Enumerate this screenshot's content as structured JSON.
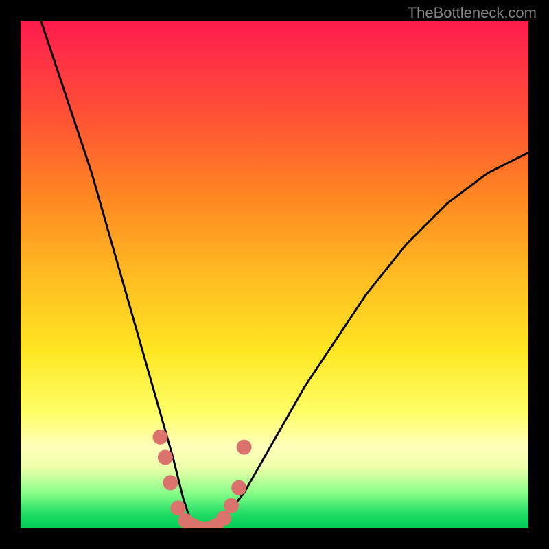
{
  "watermark": "TheBottleneck.com",
  "chart_data": {
    "type": "line",
    "title": "",
    "xlabel": "",
    "ylabel": "",
    "xlim": [
      0,
      100
    ],
    "ylim": [
      0,
      100
    ],
    "series": [
      {
        "name": "bottleneck-curve",
        "x": [
          4,
          6,
          8,
          10,
          12,
          14,
          16,
          18,
          20,
          22,
          24,
          26,
          28,
          30,
          31,
          32,
          33,
          34,
          36,
          38,
          40,
          44,
          48,
          52,
          56,
          60,
          64,
          68,
          72,
          76,
          80,
          84,
          88,
          92,
          96,
          100
        ],
        "values": [
          100,
          94,
          88,
          82,
          76,
          70,
          63,
          56,
          49,
          42,
          35,
          28,
          21,
          14,
          10,
          6,
          3,
          1,
          0,
          0,
          2,
          7,
          14,
          21,
          28,
          34,
          40,
          46,
          51,
          56,
          60,
          64,
          67,
          70,
          72,
          74
        ]
      }
    ],
    "markers": {
      "name": "highlight-dots",
      "color": "#d9736b",
      "points": [
        {
          "x": 27.5,
          "y": 18
        },
        {
          "x": 28.5,
          "y": 14
        },
        {
          "x": 29.5,
          "y": 9
        },
        {
          "x": 31,
          "y": 4
        },
        {
          "x": 32.5,
          "y": 1.5
        },
        {
          "x": 34,
          "y": 0.5
        },
        {
          "x": 35.5,
          "y": 0
        },
        {
          "x": 37,
          "y": 0
        },
        {
          "x": 38.5,
          "y": 0.5
        },
        {
          "x": 40,
          "y": 2
        },
        {
          "x": 41.5,
          "y": 4.5
        },
        {
          "x": 43,
          "y": 8
        },
        {
          "x": 44,
          "y": 16
        }
      ]
    }
  }
}
